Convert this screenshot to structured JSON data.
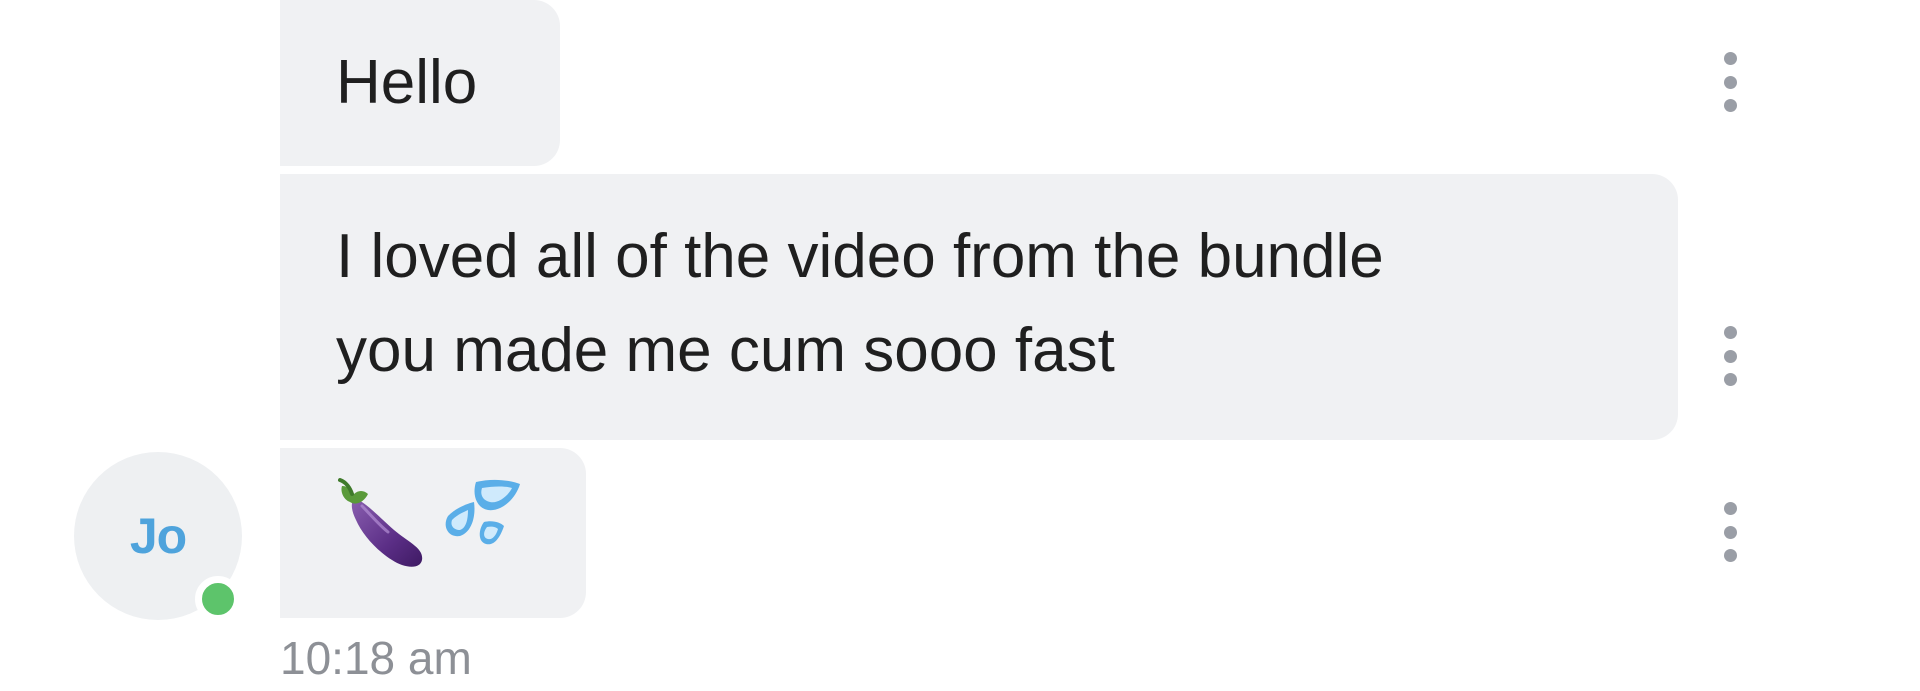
{
  "messages": [
    {
      "text": "Hello"
    },
    {
      "text": "I loved all of the video from the bundle\nyou made me cum sooo fast"
    },
    {
      "text": "🍆💦",
      "emoji_names": [
        "eggplant-emoji",
        "sweat-droplets-emoji"
      ]
    }
  ],
  "sender": {
    "initials": "Jo",
    "status": "online",
    "status_color": "#5dc46b",
    "initials_color": "#4ea3dc"
  },
  "timestamp": "10:18 am",
  "icons": {
    "message_menu": "vertical-ellipsis-icon"
  },
  "colors": {
    "bubble_bg": "#f0f1f3",
    "text": "#1f1f1f",
    "timestamp": "#8d9096",
    "menu_dots": "#9a9ea6"
  }
}
